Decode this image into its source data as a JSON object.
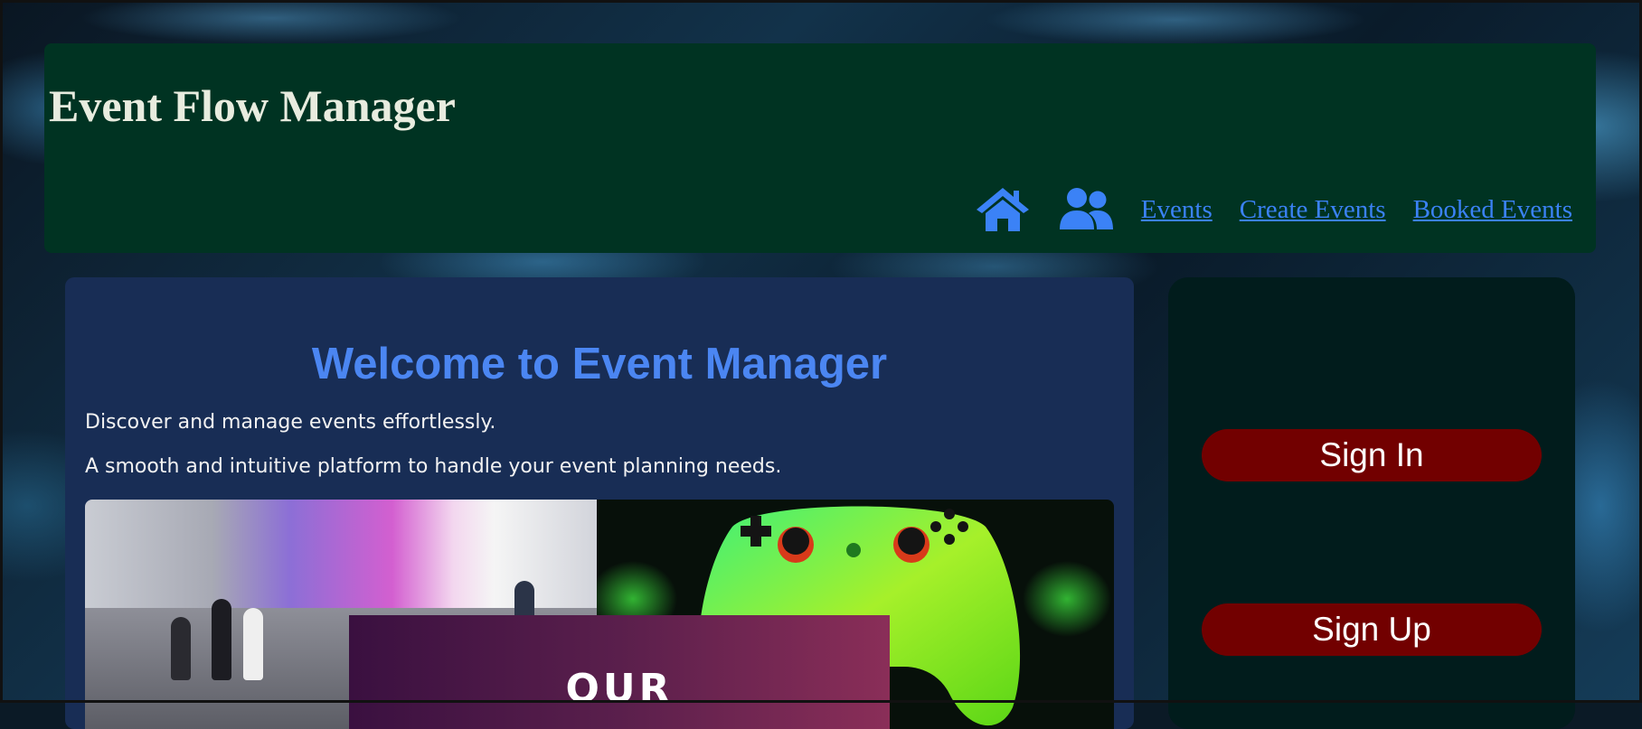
{
  "header": {
    "title": "Event Flow Manager",
    "nav": {
      "home_icon": "home-icon",
      "users_icon": "users-icon",
      "links": [
        "Events",
        "Create Events",
        "Booked Events"
      ],
      "link_color": "#3b82f6"
    },
    "background": "#003322"
  },
  "main": {
    "heading": "Welcome to Event Manager",
    "intro": "Discover and manage events effortlessly.",
    "description": "A smooth and intuitive platform to handle your event planning needs.",
    "gallery": {
      "promo_text": "OUR"
    },
    "background": "#182d55",
    "heading_color": "#4b86f2"
  },
  "auth": {
    "sign_in": "Sign In",
    "sign_up": "Sign Up",
    "button_color": "#720000",
    "background": "#011c1c"
  }
}
